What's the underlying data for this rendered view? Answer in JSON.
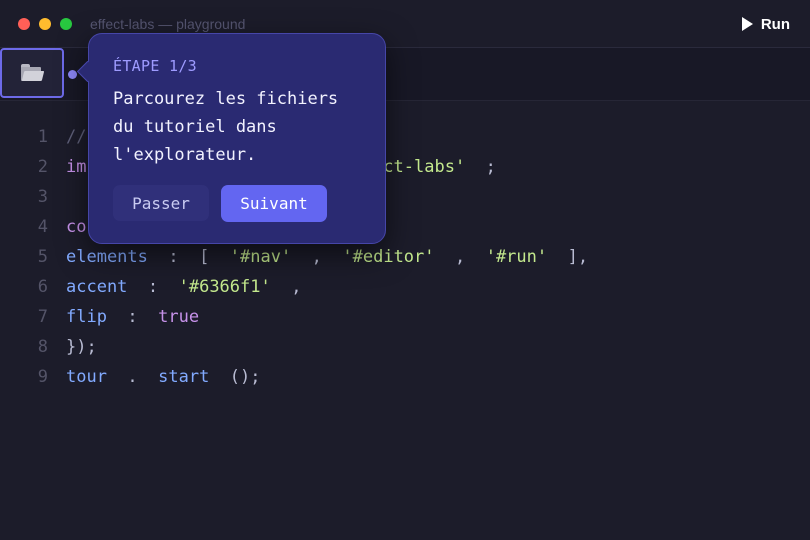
{
  "window": {
    "title": "effect-labs — playground",
    "run_label": "Run"
  },
  "sidebar": {
    "folder_icon": "folder-icon"
  },
  "editor": {
    "lines": [
      {
        "n": "1",
        "tokens": [
          {
            "t": "// ",
            "c": "comment"
          }
        ]
      },
      {
        "n": "2",
        "tokens": [
          {
            "t": "im",
            "c": "kw"
          },
          {
            "t": "                         ",
            "c": "punc"
          },
          {
            "t": "effect-labs'",
            "c": "str"
          },
          {
            "t": "  ;",
            "c": "punc"
          }
        ]
      },
      {
        "n": "3",
        "tokens": []
      },
      {
        "n": "4",
        "tokens": [
          {
            "t": "co",
            "c": "kw"
          },
          {
            "t": "                         ({",
            "c": "punc"
          }
        ]
      },
      {
        "n": "5",
        "tokens": [
          {
            "t": "elements",
            "c": "id"
          },
          {
            "t": "  :  [  ",
            "c": "punc"
          },
          {
            "t": "'#nav'",
            "c": "str"
          },
          {
            "t": "  ,  ",
            "c": "punc"
          },
          {
            "t": "'#editor'",
            "c": "str"
          },
          {
            "t": "  ,  ",
            "c": "punc"
          },
          {
            "t": "'#run'",
            "c": "str"
          },
          {
            "t": "  ],",
            "c": "punc"
          }
        ]
      },
      {
        "n": "6",
        "tokens": [
          {
            "t": "accent",
            "c": "id"
          },
          {
            "t": "  :  ",
            "c": "punc"
          },
          {
            "t": "'#6366f1'",
            "c": "str"
          },
          {
            "t": "  ,",
            "c": "punc"
          }
        ]
      },
      {
        "n": "7",
        "tokens": [
          {
            "t": "flip",
            "c": "id"
          },
          {
            "t": "  :  ",
            "c": "punc"
          },
          {
            "t": "true",
            "c": "kw"
          }
        ]
      },
      {
        "n": "8",
        "tokens": [
          {
            "t": "});",
            "c": "punc"
          }
        ]
      },
      {
        "n": "9",
        "tokens": [
          {
            "t": "tour",
            "c": "id"
          },
          {
            "t": "  .  ",
            "c": "punc"
          },
          {
            "t": "start",
            "c": "id"
          },
          {
            "t": "  ();",
            "c": "punc"
          }
        ]
      }
    ]
  },
  "tour": {
    "step": "ÉTAPE 1/3",
    "line1": "Parcourez les fichiers",
    "line2": "du tutoriel dans",
    "line3": "l'explorateur.",
    "skip_label": "Passer",
    "next_label": "Suivant"
  },
  "colors": {
    "accent": "#6366f1",
    "popover_bg": "#2a2a72",
    "editor_bg": "#1c1c2a",
    "string": "#c3e88d",
    "keyword": "#c792ea",
    "identifier": "#82aaff"
  }
}
